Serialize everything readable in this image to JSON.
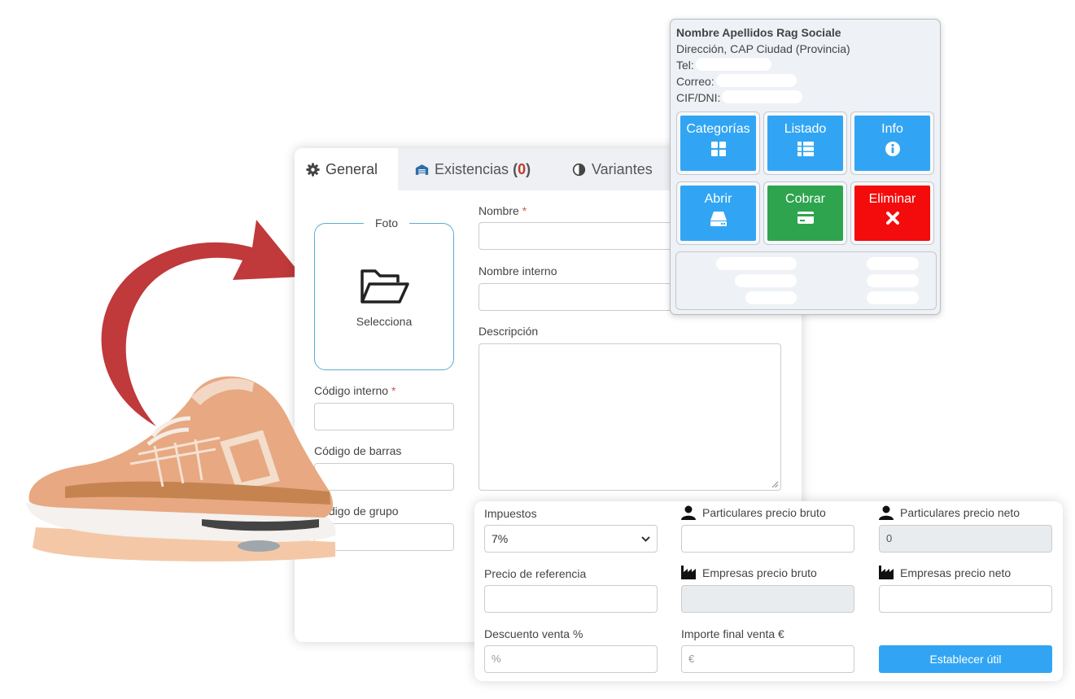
{
  "tabs": [
    {
      "label": "General",
      "icon": "gear-icon"
    },
    {
      "label": "Existencias",
      "count_open": "(",
      "count": "0",
      "count_close": ")",
      "icon": "warehouse-icon"
    },
    {
      "label": "Variantes",
      "icon": "contrast-icon"
    }
  ],
  "form": {
    "photo_legend": "Foto",
    "photo_action": "Selecciona",
    "nombre_label": "Nombre",
    "nombre_interno_label": "Nombre interno",
    "descripcion_label": "Descripción",
    "codigo_interno_label": "Código interno",
    "codigo_barras_label": "Código de barras",
    "codigo_grupo_label": "Código de grupo",
    "required_mark": "*"
  },
  "customer": {
    "name": "Nombre Apellidos Rag Sociale",
    "address": "Dirección, CAP Ciudad (Provincia)",
    "tel_label": "Tel:",
    "email_label": "Correo:",
    "tax_label": "CIF/DNI:",
    "buttons": [
      {
        "label": "Categorías",
        "icon": "grid-icon",
        "color": "#31a5f3"
      },
      {
        "label": "Listado",
        "icon": "list-icon",
        "color": "#31a5f3"
      },
      {
        "label": "Info",
        "icon": "info-icon",
        "color": "#31a5f3"
      },
      {
        "label": "Abrir",
        "icon": "drive-icon",
        "color": "#31a5f3"
      },
      {
        "label": "Cobrar",
        "icon": "card-icon",
        "color": "#2ea44f"
      },
      {
        "label": "Eliminar",
        "icon": "close-icon",
        "color": "#f40b0b"
      }
    ]
  },
  "pricing": {
    "impuestos_label": "Impuestos",
    "impuestos_value": "7%",
    "part_bruto_label": "Particulares precio bruto",
    "part_neto_label": "Particulares precio neto",
    "part_neto_value": "0",
    "ref_label": "Precio de referencia",
    "emp_bruto_label": "Empresas precio bruto",
    "emp_neto_label": "Empresas precio neto",
    "descuento_label": "Descuento venta %",
    "descuento_placeholder": "%",
    "importe_label": "Importe final venta €",
    "importe_placeholder": "€",
    "action_label": "Establecer útil"
  },
  "colors": {
    "accent": "#31a5f3",
    "success": "#2ea44f",
    "danger": "#f40b0b",
    "arrow": "#c0393b"
  }
}
